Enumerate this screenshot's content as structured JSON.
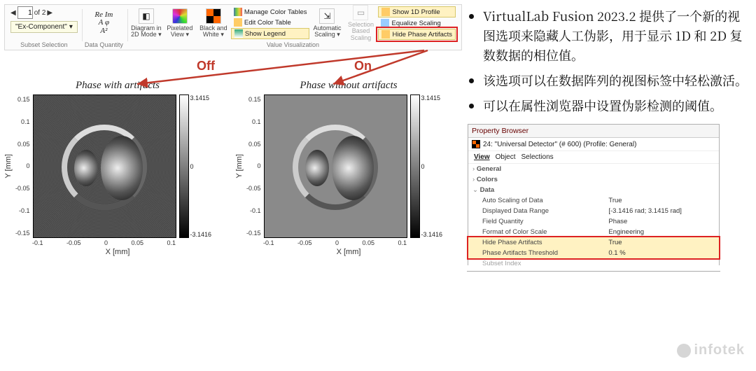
{
  "toolbar": {
    "subset_page_current": "1",
    "subset_page_total": "of 2",
    "subset_field": "\"Ex-Component\"",
    "subset_caption": "Subset Selection",
    "dq_caption": "Data Quantity",
    "dq_cells": [
      "Re",
      "Im",
      "A",
      "φ",
      "A²"
    ],
    "diagram_label": "Diagram in 2D Mode ▾",
    "pixelated_label": "Pixelated View ▾",
    "bw_label": "Black and White ▾",
    "value_caption": "Value Visualization",
    "mct": "Manage Color Tables",
    "ect": "Edit Color Table",
    "legend": "Show Legend",
    "auto_scaling": "Automatic Scaling ▾",
    "selection_based": "Selection Based Scaling",
    "show1d": "Show 1D Profile",
    "eqscale": "Equalize Scaling",
    "hidepa": "Hide Phase Artifacts"
  },
  "arrows": {
    "off": "Off",
    "on": "On"
  },
  "plots": {
    "left_title": "Phase with artifacts",
    "right_title": "Phase without artifacts",
    "y_ticks": [
      "0.15",
      "0.1",
      "0.05",
      "0",
      "-0.05",
      "-0.1",
      "-0.15"
    ],
    "x_ticks": [
      "-0.1",
      "-0.05",
      "0",
      "0.05",
      "0.1"
    ],
    "xlab": "X [mm]",
    "ylab": "Y [mm]",
    "cb_top": "3.1415",
    "cb_mid": "0",
    "cb_bot": "-3.1416"
  },
  "bullets": [
    "VirtualLab Fusion 2023.2 提供了一个新的视图选项来隐藏人工伪影，用于显示 1D 和 2D 复数数据的相位值。",
    "该选项可以在数据阵列的视图标签中轻松激活。",
    "可以在属性浏览器中设置伪影检测的阈值。"
  ],
  "prop": {
    "title": "Property Browser",
    "subtitle": "24: \"Universal Detector\" (# 600) (Profile: General)",
    "tabs": [
      "View",
      "Object",
      "Selections"
    ],
    "sections": [
      "General",
      "Colors",
      "Data"
    ],
    "rows": [
      {
        "k": "Auto Scaling of Data",
        "v": "True"
      },
      {
        "k": "Displayed Data Range",
        "v": "[-3.1416 rad; 3.1415 rad]"
      },
      {
        "k": "Field Quantity",
        "v": "Phase"
      },
      {
        "k": "Format of Color Scale",
        "v": "Engineering"
      },
      {
        "k": "Hide Phase Artifacts",
        "v": "True"
      },
      {
        "k": "Phase Artifacts Threshold",
        "v": "0.1 %"
      },
      {
        "k": "Subset Index",
        "v": ""
      }
    ]
  },
  "watermark": "infotek",
  "nav_arrows": {
    "prev": "◀",
    "next": "▶"
  }
}
